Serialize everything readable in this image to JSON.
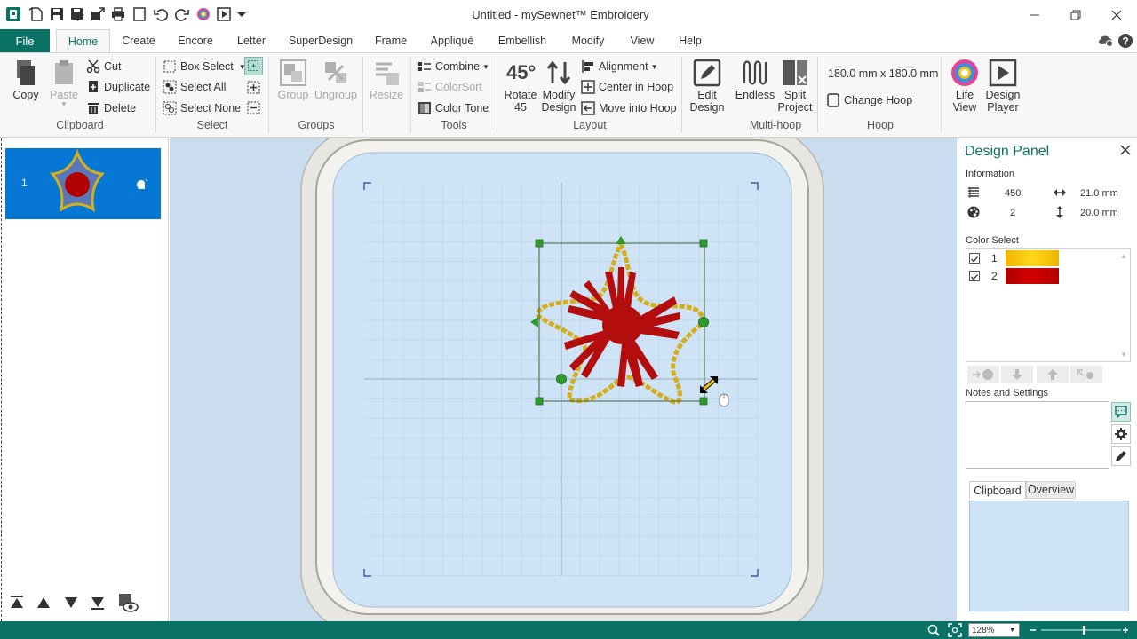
{
  "app": {
    "title": "Untitled  -  mySewnet™ Embroidery"
  },
  "menu": {
    "file": "File",
    "tabs": [
      {
        "label": "Home",
        "active": true
      },
      {
        "label": "Create"
      },
      {
        "label": "Encore"
      },
      {
        "label": "Letter"
      },
      {
        "label": "SuperDesign"
      },
      {
        "label": "Frame"
      },
      {
        "label": "Appliqué"
      },
      {
        "label": "Embellish"
      },
      {
        "label": "Modify"
      },
      {
        "label": "View"
      },
      {
        "label": "Help"
      }
    ]
  },
  "ribbon": {
    "clipboard": {
      "copy": "Copy",
      "paste": "Paste",
      "cut": "Cut",
      "duplicate": "Duplicate",
      "delete": "Delete",
      "label": "Clipboard"
    },
    "select": {
      "box_select": "Box Select",
      "select_all": "Select All",
      "select_none": "Select None",
      "label": "Select"
    },
    "groups": {
      "group": "Group",
      "ungroup": "Ungroup",
      "label": "Groups"
    },
    "resize": {
      "label": "Resize"
    },
    "tools": {
      "combine": "Combine",
      "colorsort": "ColorSort",
      "color_tone": "Color Tone",
      "label": "Tools"
    },
    "layout": {
      "rotate_line1": "Rotate",
      "rotate_line2": "45",
      "rotate_icon_text": "45°",
      "modify_line1": "Modify",
      "modify_line2": "Design",
      "alignment": "Alignment",
      "center_in_hoop": "Center in Hoop",
      "move_into_hoop": "Move into Hoop",
      "label": "Layout"
    },
    "multihoop": {
      "edit_line1": "Edit",
      "edit_line2": "Design",
      "endless": "Endless",
      "split_line1": "Split",
      "split_line2": "Project",
      "label": "Multi-hoop"
    },
    "hoop": {
      "size": "180.0 mm x 180.0 mm",
      "change_hoop": "Change Hoop",
      "label": "Hoop"
    },
    "view": {
      "life_line1": "Life",
      "life_line2": "View",
      "player_line1": "Design",
      "player_line2": "Player"
    }
  },
  "layers": {
    "items": [
      {
        "number": "1"
      }
    ]
  },
  "design_panel": {
    "title": "Design Panel",
    "information_label": "Information",
    "stitches": "450",
    "width": "21.0 mm",
    "colors": "2",
    "height": "20.0 mm",
    "color_select_label": "Color Select",
    "colors_list": [
      {
        "number": "1",
        "checked": true,
        "color": "#f5c400"
      },
      {
        "number": "2",
        "checked": true,
        "color": "#c00000"
      }
    ],
    "notes_label": "Notes and Settings",
    "tab_clipboard": "Clipboard",
    "tab_overview": "Overview"
  },
  "status": {
    "zoom": "128%"
  },
  "theme": {
    "accent": "#0a7165",
    "layer_highlight": "#0777d6",
    "canvas_bg": "#c9ddef"
  }
}
